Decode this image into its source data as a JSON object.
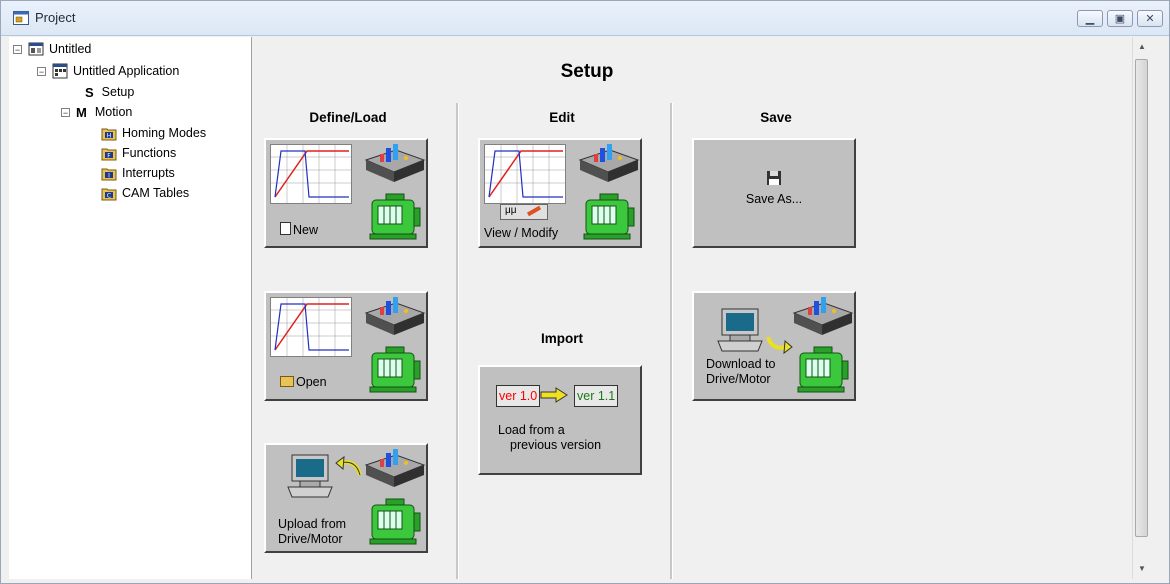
{
  "window": {
    "title": "Project"
  },
  "tree": {
    "root": "Untitled",
    "application": "Untitled Application",
    "setup_letter": "S",
    "setup": "Setup",
    "motion_letter": "M",
    "motion": "Motion",
    "children": [
      "Homing Modes",
      "Functions",
      "Interrupts",
      "CAM Tables"
    ]
  },
  "page": {
    "title": "Setup",
    "columns": {
      "define_load": "Define/Load",
      "edit": "Edit",
      "save": "Save",
      "import": "Import"
    },
    "buttons": {
      "new": "New",
      "open": "Open",
      "upload_line1": "Upload from",
      "upload_line2": "Drive/Motor",
      "view_modify": "View / Modify",
      "load_line1": "Load from a",
      "load_line2": "previous version",
      "ver_old": "ver 1.0",
      "ver_new": "ver 1.1",
      "save_as": "Save As...",
      "download_line1": "Download to",
      "download_line2": "Drive/Motor"
    }
  },
  "colors": {
    "accent_red": "#ff0000",
    "motor_green": "#3cc83c",
    "page_bg": "#f0f0f0"
  }
}
